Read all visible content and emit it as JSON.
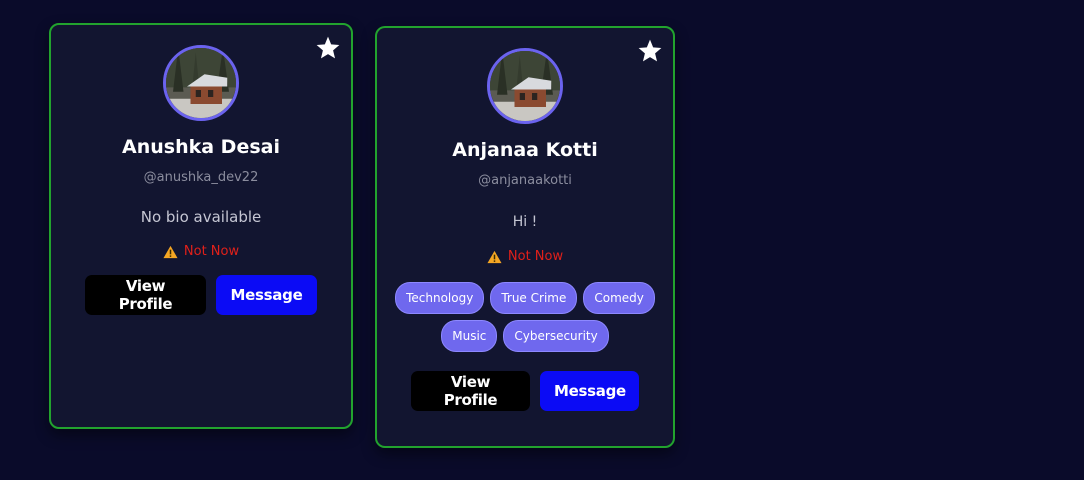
{
  "cards": [
    {
      "name": "Anushka Desai",
      "handle": "@anushka_dev22",
      "bio": "No bio available",
      "status": "Not Now",
      "tags": [],
      "view_label": "View Profile",
      "message_label": "Message",
      "avatar_icon": "cabin-photo-avatar",
      "favorite_icon": "star-icon"
    },
    {
      "name": "Anjanaa Kotti",
      "handle": "@anjanaakotti",
      "bio": "Hi !",
      "status": "Not Now",
      "tags": [
        "Technology",
        "True Crime",
        "Comedy",
        "Music",
        "Cybersecurity"
      ],
      "view_label": "View Profile",
      "message_label": "Message",
      "avatar_icon": "cabin-photo-avatar",
      "favorite_icon": "star-icon"
    }
  ],
  "colors": {
    "background": "#0a0b2a",
    "card_border": "#22a32e",
    "avatar_ring": "#6b63ef",
    "tag_bg": "#6f68ee",
    "status_red": "#e0201a",
    "warning_orange": "#f5a623",
    "message_button": "#0b0bf5",
    "view_button": "#000000"
  }
}
